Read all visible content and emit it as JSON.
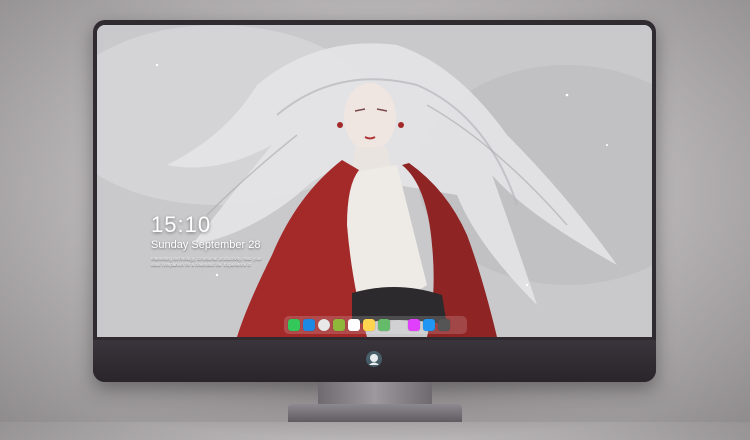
{
  "lockscreen": {
    "time": "15:10",
    "date": "Sunday September 28",
    "tagline": "Interesting technology. Emotional productivity. Mac your ideal companion for a cinematic life. Experience it!"
  },
  "dock": {
    "items": [
      {
        "name": "messages",
        "color": "#34c759"
      },
      {
        "name": "finder",
        "color": "#1e88e5"
      },
      {
        "name": "safari",
        "color": "#e8e8e8"
      },
      {
        "name": "photos",
        "color": "#8fb83b"
      },
      {
        "name": "clips",
        "color": "#ffffff"
      },
      {
        "name": "notes",
        "color": "#ffd54f"
      },
      {
        "name": "maps",
        "color": "#66bb6a"
      },
      {
        "name": "itunes",
        "color": "#e040fb"
      },
      {
        "name": "app-store",
        "color": "#2196f3"
      },
      {
        "name": "camera",
        "color": "#555555"
      }
    ]
  },
  "colors": {
    "bezel": "#2f2b31",
    "robe_red": "#a42a2a",
    "hair_white": "#e9e9ea"
  }
}
